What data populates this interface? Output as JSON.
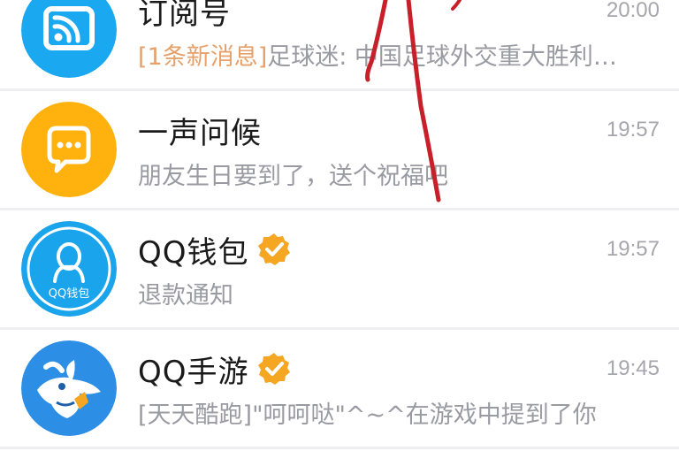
{
  "conversations": [
    {
      "title": "订阅号",
      "time": "20:00",
      "preview_tag": "[1条新消息]",
      "preview": "足球迷: 中国足球外交重大胜利…",
      "avatar_icon": "rss-feed-icon",
      "avatar_color": "#1aa9f0",
      "verified": false
    },
    {
      "title": "一声问候",
      "time": "19:57",
      "preview_tag": "",
      "preview": "朋友生日要到了，送个祝福吧",
      "avatar_icon": "chat-bubble-icon",
      "avatar_color": "#ffb10d",
      "verified": false
    },
    {
      "title": "QQ钱包",
      "time": "19:57",
      "preview_tag": "",
      "preview": "退款通知",
      "avatar_icon": "qq-wallet-icon",
      "avatar_label": "QQ钱包",
      "avatar_color": "#1aa4ec",
      "verified": true
    },
    {
      "title": "QQ手游",
      "time": "19:45",
      "preview_tag": "",
      "preview": "[天天酷跑]\"呵呵哒\"^~^在游戏中提到了你",
      "avatar_icon": "rabbit-game-icon",
      "avatar_color": "#2d8ee6",
      "verified": true
    }
  ],
  "colors": {
    "annotation_stroke": "#c8202a",
    "verified_badge": "#f5a623",
    "new_message_tag": "#e5a16b"
  }
}
